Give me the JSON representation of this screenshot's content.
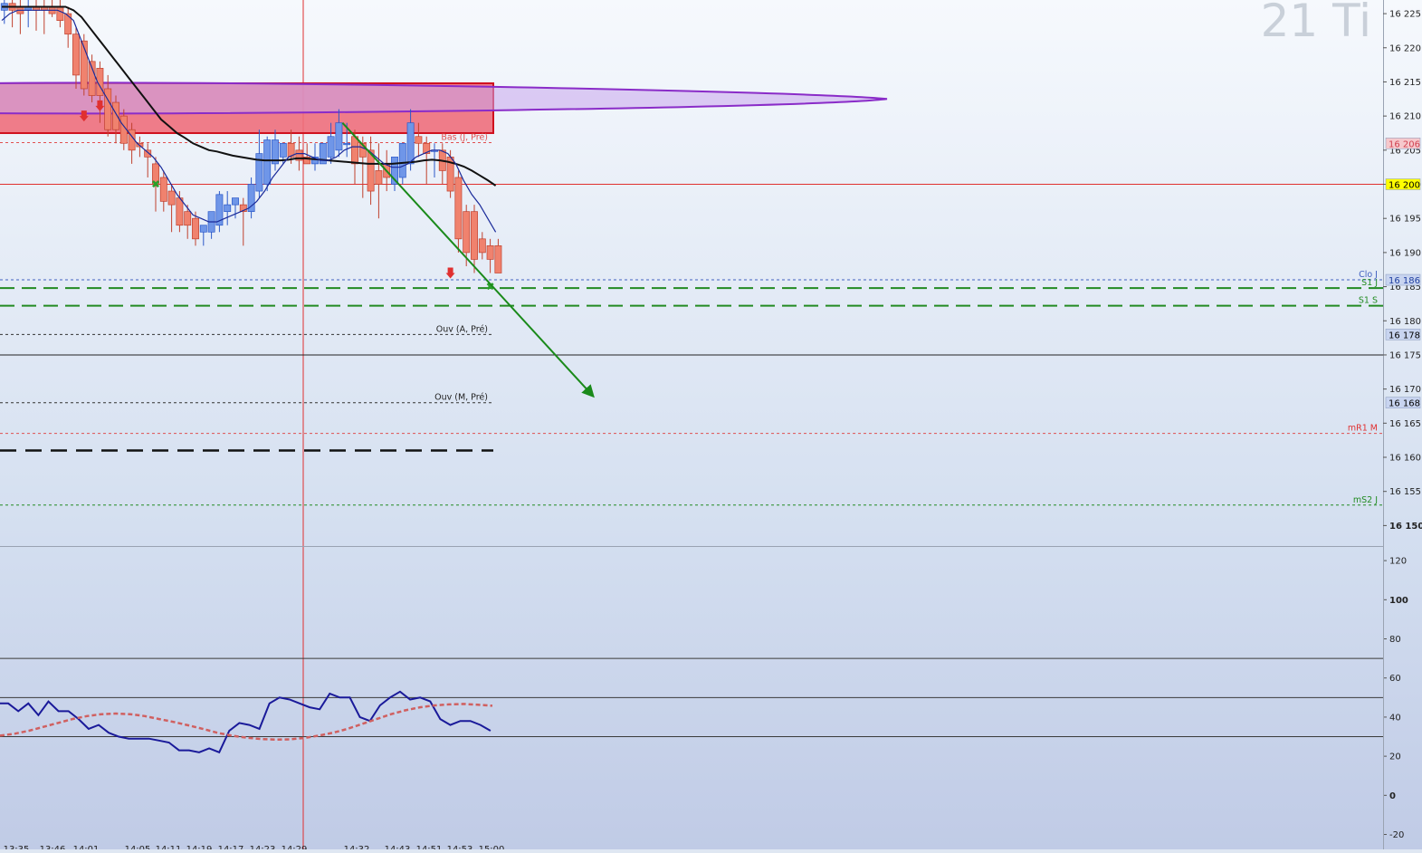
{
  "watermark": "21 Ti",
  "chart_data": [
    {
      "type": "candlestick",
      "ylim": [
        16147,
        16227
      ],
      "y_ticks": [
        16225,
        16220,
        16215,
        16210,
        16205,
        16200,
        16195,
        16190,
        16185,
        16180,
        16175,
        16170,
        16165,
        16160,
        16155,
        16150
      ],
      "y_tick_labels": [
        "16 225",
        "16 220",
        "16 215",
        "16 210",
        "16 205",
        "16 200",
        "16 195",
        "16 190",
        "16 185",
        "16 180",
        "16 175",
        "16 170",
        "16 165",
        "16 160",
        "16 155",
        "16 150"
      ],
      "bold_ticks": [
        16150
      ],
      "candles": [
        {
          "o": 16225.5,
          "h": 16227,
          "l": 16224.5,
          "c": 16226
        },
        {
          "o": 16225.5,
          "h": 16227,
          "l": 16223.5,
          "c": 16226.5
        },
        {
          "o": 16226.5,
          "h": 16227,
          "l": 16223,
          "c": 16225.5
        },
        {
          "o": 16226,
          "h": 16227,
          "l": 16222,
          "c": 16225
        },
        {
          "o": 16225.5,
          "h": 16227,
          "l": 16223,
          "c": 16226
        },
        {
          "o": 16226,
          "h": 16227,
          "l": 16222.5,
          "c": 16225.5
        },
        {
          "o": 16226,
          "h": 16227,
          "l": 16222,
          "c": 16225.5
        },
        {
          "o": 16226,
          "h": 16227,
          "l": 16224.5,
          "c": 16225
        },
        {
          "o": 16226,
          "h": 16227,
          "l": 16223,
          "c": 16224
        },
        {
          "o": 16225,
          "h": 16226,
          "l": 16220,
          "c": 16222
        },
        {
          "o": 16222,
          "h": 16223,
          "l": 16214,
          "c": 16216
        },
        {
          "o": 16221,
          "h": 16222,
          "l": 16213,
          "c": 16214
        },
        {
          "o": 16218,
          "h": 16219,
          "l": 16212,
          "c": 16213
        },
        {
          "o": 16217,
          "h": 16218,
          "l": 16209,
          "c": 16213
        },
        {
          "o": 16214,
          "h": 16216,
          "l": 16207,
          "c": 16208
        },
        {
          "o": 16212,
          "h": 16213,
          "l": 16206,
          "c": 16208
        },
        {
          "o": 16210,
          "h": 16211,
          "l": 16205,
          "c": 16206
        },
        {
          "o": 16208,
          "h": 16209,
          "l": 16203,
          "c": 16205
        },
        {
          "o": 16206,
          "h": 16207,
          "l": 16204,
          "c": 16205.5
        },
        {
          "o": 16205,
          "h": 16206,
          "l": 16201,
          "c": 16204
        },
        {
          "o": 16203,
          "h": 16204,
          "l": 16196,
          "c": 16200
        },
        {
          "o": 16201,
          "h": 16202,
          "l": 16196,
          "c": 16197.5
        },
        {
          "o": 16199,
          "h": 16200,
          "l": 16193,
          "c": 16197
        },
        {
          "o": 16198,
          "h": 16199,
          "l": 16193,
          "c": 16194
        },
        {
          "o": 16196,
          "h": 16197,
          "l": 16192,
          "c": 16194
        },
        {
          "o": 16195,
          "h": 16196,
          "l": 16191,
          "c": 16192
        },
        {
          "o": 16193,
          "h": 16194,
          "l": 16191,
          "c": 16194
        },
        {
          "o": 16193,
          "h": 16195,
          "l": 16192,
          "c": 16196
        },
        {
          "o": 16194,
          "h": 16199,
          "l": 16193,
          "c": 16198.5
        },
        {
          "o": 16196,
          "h": 16199,
          "l": 16194,
          "c": 16197
        },
        {
          "o": 16197,
          "h": 16198,
          "l": 16195,
          "c": 16198
        },
        {
          "o": 16197,
          "h": 16198,
          "l": 16191,
          "c": 16196
        },
        {
          "o": 16196,
          "h": 16201,
          "l": 16195,
          "c": 16200
        },
        {
          "o": 16199,
          "h": 16208,
          "l": 16198,
          "c": 16204.5
        },
        {
          "o": 16200,
          "h": 16207,
          "l": 16199,
          "c": 16206.5
        },
        {
          "o": 16203,
          "h": 16208,
          "l": 16202,
          "c": 16206.5
        },
        {
          "o": 16204,
          "h": 16206,
          "l": 16203,
          "c": 16206
        },
        {
          "o": 16206,
          "h": 16208,
          "l": 16203,
          "c": 16204
        },
        {
          "o": 16205,
          "h": 16207,
          "l": 16202,
          "c": 16203.5
        },
        {
          "o": 16204,
          "h": 16206,
          "l": 16203,
          "c": 16203
        },
        {
          "o": 16203,
          "h": 16206,
          "l": 16202,
          "c": 16204
        },
        {
          "o": 16203,
          "h": 16206,
          "l": 16203,
          "c": 16206
        },
        {
          "o": 16204,
          "h": 16209,
          "l": 16203,
          "c": 16207
        },
        {
          "o": 16205,
          "h": 16211,
          "l": 16204,
          "c": 16209
        },
        {
          "o": 16206,
          "h": 16209,
          "l": 16204,
          "c": 16206
        },
        {
          "o": 16207,
          "h": 16208,
          "l": 16200,
          "c": 16203
        },
        {
          "o": 16206,
          "h": 16207,
          "l": 16198,
          "c": 16204
        },
        {
          "o": 16205,
          "h": 16207,
          "l": 16197,
          "c": 16199
        },
        {
          "o": 16202,
          "h": 16206,
          "l": 16195,
          "c": 16200
        },
        {
          "o": 16203,
          "h": 16205,
          "l": 16199,
          "c": 16201
        },
        {
          "o": 16200,
          "h": 16203,
          "l": 16199,
          "c": 16204
        },
        {
          "o": 16201,
          "h": 16206,
          "l": 16200,
          "c": 16206
        },
        {
          "o": 16203,
          "h": 16211,
          "l": 16202,
          "c": 16209
        },
        {
          "o": 16207,
          "h": 16209,
          "l": 16204,
          "c": 16206
        },
        {
          "o": 16206,
          "h": 16207,
          "l": 16200,
          "c": 16204.5
        },
        {
          "o": 16205,
          "h": 16206,
          "l": 16201,
          "c": 16205
        },
        {
          "o": 16205,
          "h": 16206,
          "l": 16200,
          "c": 16202
        },
        {
          "o": 16204,
          "h": 16205,
          "l": 16198,
          "c": 16199
        },
        {
          "o": 16201,
          "h": 16202,
          "l": 16190,
          "c": 16192
        },
        {
          "o": 16196,
          "h": 16197,
          "l": 16188,
          "c": 16190
        },
        {
          "o": 16196,
          "h": 16197,
          "l": 16187,
          "c": 16189
        },
        {
          "o": 16192,
          "h": 16193,
          "l": 16189,
          "c": 16190
        },
        {
          "o": 16191,
          "h": 16192,
          "l": 16187,
          "c": 16189
        },
        {
          "o": 16191,
          "h": 16192,
          "l": 16187,
          "c": 16187
        }
      ],
      "ma_fast": [
        16224,
        16225,
        16225.5,
        16225.5,
        16225.5,
        16225.5,
        16225.5,
        16225.5,
        16225,
        16224,
        16221,
        16218,
        16215,
        16213,
        16211,
        16209,
        16207.5,
        16206,
        16205,
        16204,
        16202.5,
        16200.5,
        16198.5,
        16197,
        16195.5,
        16195,
        16194.5,
        16194.5,
        16195,
        16195.5,
        16196,
        16196.5,
        16197.5,
        16199,
        16201,
        16202.5,
        16204,
        16204.5,
        16204.5,
        16204,
        16203.5,
        16203.5,
        16204,
        16205,
        16205.5,
        16205.5,
        16205,
        16204,
        16203,
        16202.5,
        16202.5,
        16203,
        16204,
        16204.5,
        16205,
        16205,
        16204.5,
        16203,
        16200.5,
        16198.5,
        16197,
        16195,
        16193
      ],
      "ma_slow": [
        16226,
        16226,
        16226,
        16226,
        16226,
        16226,
        16226,
        16226,
        16226,
        16225.5,
        16224.5,
        16223,
        16221.5,
        16220,
        16218.5,
        16217,
        16215.5,
        16214,
        16212.5,
        16211,
        16209.5,
        16208.5,
        16207.5,
        16206.8,
        16206,
        16205.5,
        16205,
        16204.8,
        16204.5,
        16204.2,
        16204,
        16203.8,
        16203.6,
        16203.5,
        16203.5,
        16203.5,
        16203.6,
        16203.8,
        16203.8,
        16203.7,
        16203.6,
        16203.5,
        16203.4,
        16203.3,
        16203.2,
        16203.1,
        16203,
        16203,
        16203,
        16203,
        16203.1,
        16203.2,
        16203.3,
        16203.5,
        16203.6,
        16203.5,
        16203.3,
        16203,
        16202.6,
        16202,
        16201.3,
        16200.6,
        16199.8
      ],
      "resistance_zone": {
        "y_top": 16214.8,
        "y_bottom": 16207.5
      },
      "horizontal_lines": [
        {
          "name": "h-line-red",
          "y": 16200,
          "color": "#e03030",
          "style": "solid",
          "full": true
        },
        {
          "name": "h-line-bas",
          "y": 16206.1,
          "color": "#e05050",
          "style": "dotted",
          "full": false
        },
        {
          "name": "h-line-clo",
          "y": 16186,
          "color": "#4060c0",
          "style": "dotted",
          "full": true
        },
        {
          "name": "h-line-s1j",
          "y": 16184.8,
          "color": "#228b22",
          "style": "dashed-long",
          "full": true
        },
        {
          "name": "h-line-s1s",
          "y": 16182.2,
          "color": "#228b22",
          "style": "dashed-long",
          "full": true
        },
        {
          "name": "h-line-ouv-a",
          "y": 16178,
          "color": "#333333",
          "style": "dotted",
          "full": false
        },
        {
          "name": "h-line-black",
          "y": 16175,
          "color": "#222222",
          "style": "solid",
          "full": true
        },
        {
          "name": "h-line-ouv-m",
          "y": 16168,
          "color": "#333333",
          "style": "dotted",
          "full": false
        },
        {
          "name": "h-line-mr1",
          "y": 16163.5,
          "color": "#e05050",
          "style": "dotted",
          "full": true
        },
        {
          "name": "h-line-black-dash",
          "y": 16161,
          "color": "#111111",
          "style": "dashed-heavy",
          "full": false
        },
        {
          "name": "h-line-ms2",
          "y": 16153,
          "color": "#228b22",
          "style": "dotted",
          "full": true
        }
      ],
      "level_labels": [
        {
          "text": "Bas (J, Pré)",
          "y": 16206.1,
          "color": "#e05050",
          "anchor": "right-of-candles"
        },
        {
          "text": "Ouv (A, Pré)",
          "y": 16178,
          "color": "#222222",
          "anchor": "right-of-candles"
        },
        {
          "text": "Ouv (M, Pré)",
          "y": 16168,
          "color": "#222222",
          "anchor": "right-of-candles"
        },
        {
          "text": "Clo J",
          "y": 16186,
          "color": "#4060c0",
          "anchor": "right"
        },
        {
          "text": "S1 J",
          "y": 16184.8,
          "color": "#228b22",
          "anchor": "right"
        },
        {
          "text": "S1 S",
          "y": 16182.2,
          "color": "#228b22",
          "anchor": "right"
        },
        {
          "text": "mR1 M",
          "y": 16163.5,
          "color": "#e03030",
          "anchor": "right"
        },
        {
          "text": "mS2 J",
          "y": 16153,
          "color": "#228b22",
          "anchor": "right"
        }
      ],
      "price_badges": [
        {
          "text": "16 206",
          "y": 16206,
          "bg": "#f6c8cc",
          "fg": "#d04050"
        },
        {
          "text": "16 200",
          "y": 16200,
          "bg": "#ffff00",
          "fg": "#000000"
        },
        {
          "text": "16 186",
          "y": 16186,
          "bg": "#c8d4f0",
          "fg": "#2040a0"
        },
        {
          "text": "16 178",
          "y": 16178,
          "bg": "#c8d4f0",
          "fg": "#000000"
        },
        {
          "text": "16 168",
          "y": 16168,
          "bg": "#c8d4f0",
          "fg": "#000000"
        }
      ],
      "projection_arrow": {
        "from_index": 43,
        "from_y": 16209,
        "to_index": 62,
        "to_y": 16169
      },
      "x_tick_labels": [
        "13:35",
        "13:46",
        "14:01",
        "14:05",
        "14:11",
        "14:19",
        "14:17",
        "14:23",
        "14:29",
        "14:32",
        "14:43",
        "14:51",
        "14:53",
        "15:00"
      ]
    },
    {
      "type": "line",
      "ylim": [
        -23,
        127
      ],
      "y_ticks": [
        120,
        100,
        80,
        60,
        40,
        20,
        0,
        -20
      ],
      "y_tick_labels": [
        "120",
        "100",
        "80",
        "60",
        "40",
        "20",
        "0",
        "-20"
      ],
      "bold_ticks": [
        100,
        0
      ],
      "levels": [
        70,
        50,
        30
      ],
      "series": [
        {
          "type": "line",
          "color": "#1a1a9a",
          "values": [
            47,
            47,
            43,
            47,
            41,
            48,
            43,
            43,
            39,
            34,
            36,
            32,
            30,
            29,
            29,
            29,
            28,
            27,
            23,
            23,
            22,
            24,
            22,
            33,
            37,
            36,
            34,
            47,
            50,
            49,
            47,
            45,
            44,
            52,
            50,
            50,
            40,
            38,
            46,
            50,
            53,
            49,
            50,
            48,
            39,
            36,
            38,
            38,
            36,
            33
          ]
        },
        {
          "type": "line",
          "color": "#d06060",
          "style": "dashed",
          "values": [
            30.5,
            31.5,
            33,
            35,
            37,
            39,
            40.5,
            41.5,
            41.8,
            41.5,
            40.5,
            39,
            37.5,
            35.8,
            34,
            32,
            30.5,
            29.5,
            28.8,
            28.5,
            28.6,
            29.3,
            30.5,
            32,
            34,
            36.5,
            39,
            41.5,
            43.5,
            45,
            46,
            46.5,
            46.7,
            46.3,
            45.8
          ]
        }
      ],
      "x_tick_labels": []
    }
  ]
}
